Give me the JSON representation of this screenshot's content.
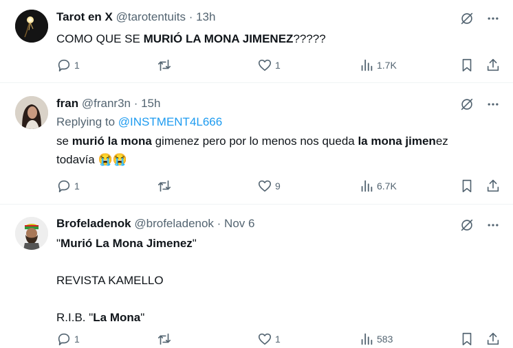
{
  "tweets": [
    {
      "name": "Tarot en X",
      "handle": "@tarotentuits",
      "time": "13h",
      "text_parts": [
        "COMO QUE SE ",
        "MURIÓ LA MONA JIMENEZ",
        "?????"
      ],
      "replies": "1",
      "retweets": "",
      "likes": "1",
      "views": "1.7K"
    },
    {
      "name": "fran",
      "handle": "@franr3n",
      "time": "15h",
      "replying_label": "Replying to",
      "replying_handle": "@INSTMENT4L666",
      "text_parts": [
        "se ",
        "murió la mona",
        " gimenez pero por lo menos nos queda ",
        "la mona jimen",
        "ez",
        "todavía",
        "😭😭"
      ],
      "replies": "1",
      "retweets": "",
      "likes": "9",
      "views": "6.7K"
    },
    {
      "name": "Brofeladenok",
      "handle": "@brofeladenok",
      "time": "Nov 6",
      "line1": [
        "\"",
        "Murió La Mona Jimenez",
        "\""
      ],
      "line2": "REVISTA KAMELLO",
      "line3": [
        "R.I.B. \"",
        "La Mona",
        "\""
      ],
      "replies": "1",
      "retweets": "",
      "likes": "1",
      "views": "583"
    }
  ],
  "separator": " · ",
  "icons": {
    "reply": "reply-icon",
    "retweet": "retweet-icon",
    "like": "heart-icon",
    "views": "views-icon",
    "bookmark": "bookmark-icon",
    "share": "share-icon",
    "grok": "grok-icon",
    "more": "more-icon"
  },
  "colors": {
    "text": "#0f1419",
    "secondary": "#536471",
    "link": "#1d9bf0",
    "divider": "#eff3f4"
  }
}
